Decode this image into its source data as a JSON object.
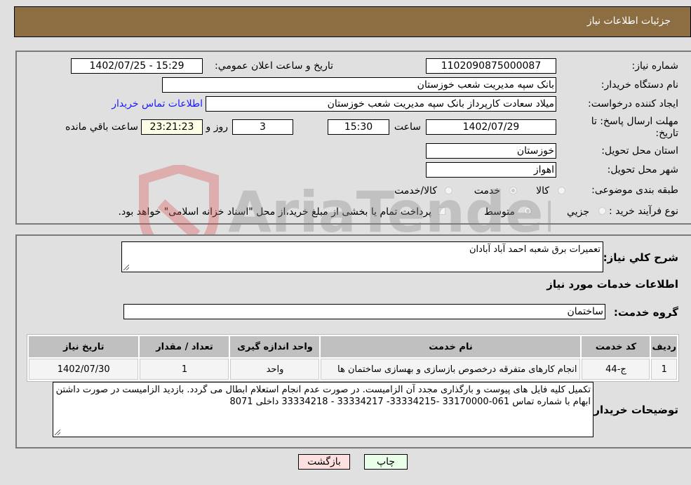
{
  "header": {
    "title": "جزئیات اطلاعات نیاز"
  },
  "details": {
    "need_number_label": "شماره نیاز:",
    "need_number": "1102090875000087",
    "announce_label": "تاریخ و ساعت اعلان عمومي:",
    "announce_value": "1402/07/25 - 15:29",
    "buyer_org_label": "نام دستگاه خریدار:",
    "buyer_org": "بانک سپه مدیریت شعب خوزستان",
    "creator_label": "ایجاد کننده درخواست:",
    "creator": "میلاد سعادت کارپرداز بانک سپه مدیریت شعب خوزستان",
    "contact_link": "اطلاعات تماس خریدار",
    "deadline_label_line1": "مهلت ارسال پاسخ: تا",
    "deadline_label_line2": "تاریخ:",
    "deadline_date": "1402/07/29",
    "time_label": "ساعت",
    "deadline_time": "15:30",
    "days_value": "3",
    "days_label": "روز و",
    "remaining_time": "23:21:23",
    "remaining_label": "ساعت باقي مانده",
    "province_label": "استان محل تحویل:",
    "province": "خوزستان",
    "city_label": "شهر محل تحویل:",
    "city": "اهواز",
    "category_label": "طبقه بندی موضوعی:",
    "category_options": [
      {
        "label": "کالا",
        "checked": false
      },
      {
        "label": "خدمت",
        "checked": true
      },
      {
        "label": "کالا/خدمت",
        "checked": false
      }
    ],
    "process_label": "نوع فرآیند خرید :",
    "process_options": [
      {
        "label": "جزيي",
        "checked": false
      },
      {
        "label": "متوسط",
        "checked": true
      }
    ],
    "treasury_note": "پرداخت تمام یا بخشی از مبلغ خرید،از محل \"اسناد خزانه اسلامی\" خواهد بود."
  },
  "services": {
    "summary_label": "شرح کلي نیاز:",
    "summary": "تعمیرات برق شعبه احمد آباد آبادان",
    "section_title": "اطلاعات خدمات مورد نیاز",
    "group_label": "گروه خدمت:",
    "group": "ساختمان",
    "table": {
      "headers": [
        "ردیف",
        "کد خدمت",
        "نام خدمت",
        "واحد اندازه گیری",
        "تعداد / مقدار",
        "تاریخ نیاز"
      ],
      "rows": [
        [
          "1",
          "ج-44",
          "انجام کارهای متفرقه درخصوص بازسازی و بهسازی ساختمان ها",
          "واحد",
          "1",
          "1402/07/30"
        ]
      ]
    },
    "buyer_notes_label": "توضیحات خریدار:",
    "buyer_notes": "تکمیل کلیه فایل های پیوست و بارگذاری مجدد آن الزامیست. در صورت عدم انجام استعلام ابطال می گردد. بازدید الزامیست در صورت داشتن ابهام با شماره تماس 061-33170000 -33334215- 33334217 - 33334218 داخلی 8071"
  },
  "buttons": {
    "print": "چاپ",
    "back": "بازگشت"
  },
  "watermark": {
    "text": "AriaTender.neT"
  }
}
